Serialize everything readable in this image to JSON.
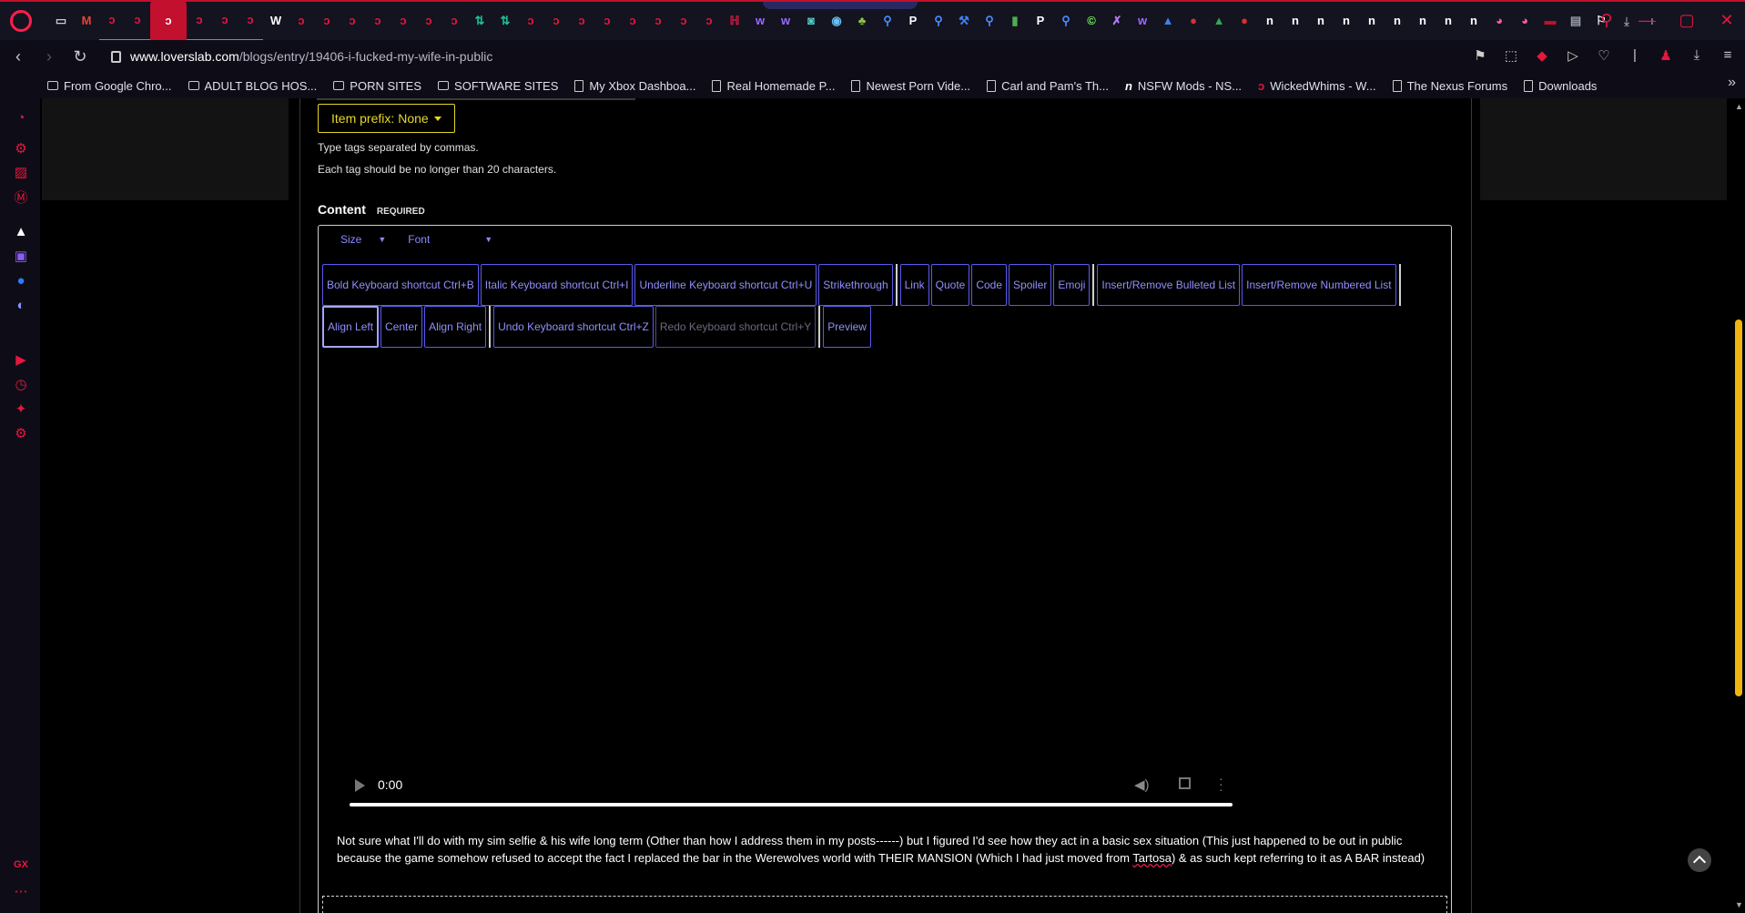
{
  "browser": {
    "url_host": "www.loverslab.com",
    "url_path": "/blogs/entry/19406-i-fucked-my-wife-in-public",
    "tabs": [
      {
        "icon": "tab-icon-generic",
        "glyph": "▭"
      },
      {
        "icon": "gmail-icon",
        "glyph": "M"
      },
      {
        "icon": "loverslab-icon",
        "glyph": "ↄ"
      },
      {
        "icon": "loverslab-icon",
        "glyph": "ↄ"
      },
      {
        "icon": "loverslab-icon",
        "glyph": "ↄ",
        "active": true
      },
      {
        "icon": "loverslab-icon",
        "glyph": "ↄ"
      },
      {
        "icon": "loverslab-icon",
        "glyph": "ↄ"
      },
      {
        "icon": "loverslab-icon",
        "glyph": "ↄ"
      },
      {
        "icon": "wix-icon",
        "glyph": "W"
      },
      {
        "icon": "loverslab-icon",
        "glyph": "ↄ"
      },
      {
        "icon": "loverslab-icon",
        "glyph": "ↄ"
      },
      {
        "icon": "loverslab-icon",
        "glyph": "ↄ"
      },
      {
        "icon": "loverslab-icon",
        "glyph": "ↄ"
      },
      {
        "icon": "loverslab-icon",
        "glyph": "ↄ"
      },
      {
        "icon": "loverslab-icon",
        "glyph": "ↄ"
      },
      {
        "icon": "loverslab-icon",
        "glyph": "ↄ"
      },
      {
        "icon": "exchange-icon",
        "glyph": "⇅"
      },
      {
        "icon": "exchange-icon",
        "glyph": "⇅"
      },
      {
        "icon": "loverslab-icon",
        "glyph": "ↄ"
      },
      {
        "icon": "loverslab-icon",
        "glyph": "ↄ"
      },
      {
        "icon": "loverslab-icon",
        "glyph": "ↄ"
      },
      {
        "icon": "loverslab-icon",
        "glyph": "ↄ"
      },
      {
        "icon": "loverslab-icon",
        "glyph": "ↄ"
      },
      {
        "icon": "loverslab-icon",
        "glyph": "ↄ"
      },
      {
        "icon": "loverslab-icon",
        "glyph": "ↄ"
      },
      {
        "icon": "loverslab-icon",
        "glyph": "ↄ"
      },
      {
        "icon": "red-logo-icon",
        "glyph": "ℍ"
      },
      {
        "icon": "twitch-w-icon",
        "glyph": "w"
      },
      {
        "icon": "twitch-w-icon",
        "glyph": "w"
      },
      {
        "icon": "game-icon",
        "glyph": "◙"
      },
      {
        "icon": "steam-icon",
        "glyph": "◉"
      },
      {
        "icon": "tree-icon",
        "glyph": "♣"
      },
      {
        "icon": "search-icon",
        "glyph": "⚲"
      },
      {
        "icon": "p-icon",
        "glyph": "P"
      },
      {
        "icon": "search-icon",
        "glyph": "⚲"
      },
      {
        "icon": "wrench-icon",
        "glyph": "⚒"
      },
      {
        "icon": "search-icon",
        "glyph": "⚲"
      },
      {
        "icon": "note-icon",
        "glyph": "▮"
      },
      {
        "icon": "p-icon",
        "glyph": "P"
      },
      {
        "icon": "search-icon",
        "glyph": "⚲"
      },
      {
        "icon": "c-icon",
        "glyph": "©"
      },
      {
        "icon": "x-icon",
        "glyph": "✗"
      },
      {
        "icon": "twitch-w-icon",
        "glyph": "w"
      },
      {
        "icon": "steam-store-icon",
        "glyph": "▲"
      },
      {
        "icon": "red-circle-icon",
        "glyph": "●"
      },
      {
        "icon": "drive-icon",
        "glyph": "▲"
      },
      {
        "icon": "red-circle-icon",
        "glyph": "●"
      },
      {
        "icon": "n-icon",
        "glyph": "n"
      },
      {
        "icon": "n-icon",
        "glyph": "n"
      },
      {
        "icon": "n-icon",
        "glyph": "n"
      },
      {
        "icon": "n-icon",
        "glyph": "n"
      },
      {
        "icon": "n-icon",
        "glyph": "n"
      },
      {
        "icon": "n-icon",
        "glyph": "n"
      },
      {
        "icon": "n-icon",
        "glyph": "n"
      },
      {
        "icon": "n-icon",
        "glyph": "n"
      },
      {
        "icon": "n-icon",
        "glyph": "n"
      },
      {
        "icon": "circle-icon",
        "glyph": "◕"
      },
      {
        "icon": "circle-icon",
        "glyph": "◕"
      },
      {
        "icon": "red-tag-icon",
        "glyph": "▬"
      },
      {
        "icon": "chat-icon",
        "glyph": "▤"
      },
      {
        "icon": "map-pin-icon",
        "glyph": "⚐"
      }
    ],
    "bookmarks": [
      {
        "label": "From Google Chro...",
        "icon": "folder-icon"
      },
      {
        "label": "ADULT BLOG HOS...",
        "icon": "folder-icon"
      },
      {
        "label": "PORN SITES",
        "icon": "folder-icon"
      },
      {
        "label": "SOFTWARE SITES",
        "icon": "folder-icon"
      },
      {
        "label": "My Xbox Dashboa...",
        "icon": "page-icon"
      },
      {
        "label": "Real Homemade P...",
        "icon": "page-icon"
      },
      {
        "label": "Newest Porn Vide...",
        "icon": "page-icon"
      },
      {
        "label": "Carl and Pam's Th...",
        "icon": "page-icon"
      },
      {
        "label": "NSFW Mods - NS...",
        "icon": "n-icon"
      },
      {
        "label": "WickedWhims - W...",
        "icon": "wickedwhims-icon"
      },
      {
        "label": "The Nexus Forums",
        "icon": "page-icon"
      },
      {
        "label": "Downloads",
        "icon": "page-icon"
      }
    ],
    "gx_label": "GX",
    "accent_color": "#e5173e"
  },
  "form": {
    "item_prefix_label": "Item prefix:",
    "item_prefix_value": "None",
    "tags_help_1": "Type tags separated by commas.",
    "tags_help_2": "Each tag should be no longer than 20 characters.",
    "content_label": "Content",
    "content_required": "REQUIRED"
  },
  "editor": {
    "size_label": "Size",
    "font_label": "Font",
    "toolbar_row1": [
      {
        "label": "Bold Keyboard shortcut Ctrl+B",
        "name": "bold-button"
      },
      {
        "label": "Italic Keyboard shortcut Ctrl+I",
        "name": "italic-button"
      },
      {
        "label": "Underline Keyboard shortcut Ctrl+U",
        "name": "underline-button"
      },
      {
        "label": "Strikethrough",
        "name": "strikethrough-button"
      },
      {
        "sep": true
      },
      {
        "label": "Link",
        "name": "link-button"
      },
      {
        "label": "Quote",
        "name": "quote-button"
      },
      {
        "label": "Code",
        "name": "code-button"
      },
      {
        "label": "Spoiler",
        "name": "spoiler-button"
      },
      {
        "label": "Emoji",
        "name": "emoji-button"
      },
      {
        "sep": true
      },
      {
        "label": "Insert/Remove Bulleted List",
        "name": "bulleted-list-button"
      },
      {
        "label": "Insert/Remove Numbered List",
        "name": "numbered-list-button"
      },
      {
        "sep": true
      }
    ],
    "toolbar_row2": [
      {
        "label": "Align Left",
        "name": "align-left-button",
        "selected": true
      },
      {
        "label": "Center",
        "name": "align-center-button"
      },
      {
        "label": "Align Right",
        "name": "align-right-button"
      },
      {
        "sep": true
      },
      {
        "label": "Undo Keyboard shortcut Ctrl+Z",
        "name": "undo-button"
      },
      {
        "label": "Redo Keyboard shortcut Ctrl+Y",
        "name": "redo-button",
        "disabled": true
      },
      {
        "sep": true
      },
      {
        "label": "Preview",
        "name": "preview-button"
      }
    ],
    "video_time": "0:00",
    "body_text_before": "Not sure what I'll do with my sim selfie & his wife long term (Other than how I address them in my posts------) but I figured I'd see how they act in a basic sex situation (This just happened to be out in public because the game somehow refused to accept the fact I replaced the bar in the Werewolves world with THEIR MANSION (Which I had just moved from ",
    "body_text_misspelled": "Tartosa",
    "body_text_after": ") & as such kept referring to it as A BAR instead)"
  }
}
